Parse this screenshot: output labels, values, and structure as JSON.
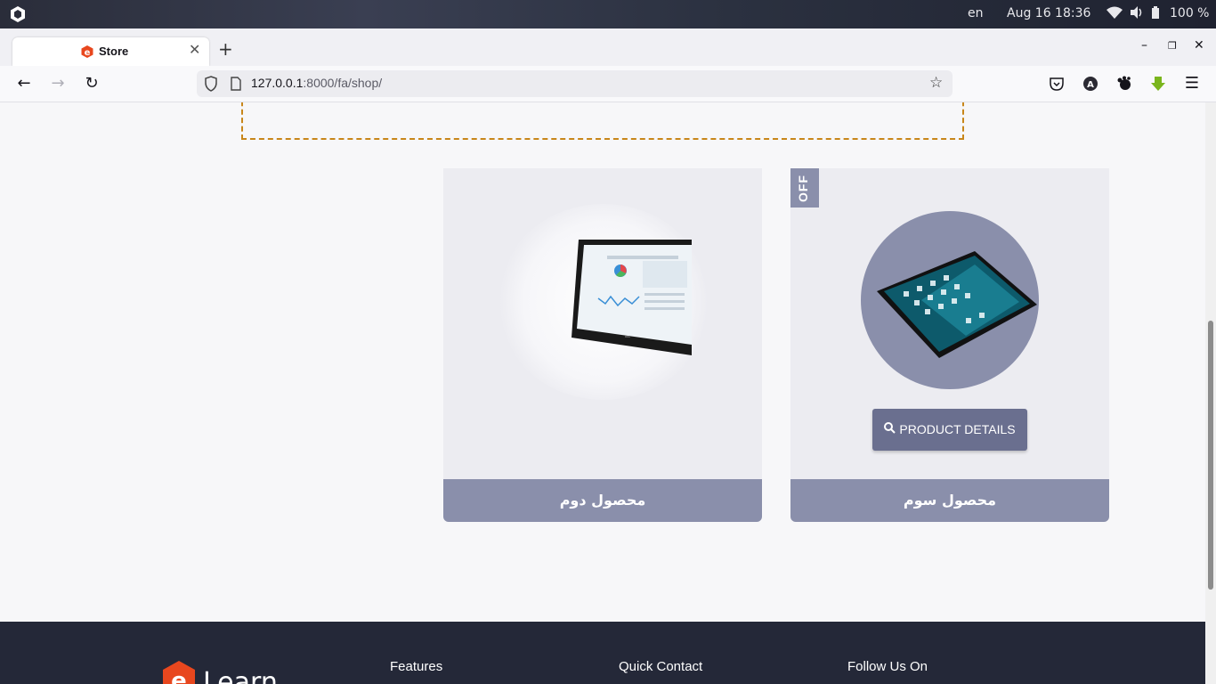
{
  "os": {
    "lang": "en",
    "datetime": "Aug 16  18:36",
    "battery": "100 %",
    "icons": [
      "distro-logo-icon",
      "wifi-icon",
      "volume-icon",
      "battery-icon"
    ]
  },
  "browser": {
    "tab_title": "Store",
    "url_host": "127.0.0.1",
    "url_path": ":8000/fa/shop/",
    "toolbar_icons": [
      "pocket-icon",
      "account-icon",
      "gnome-extension-icon",
      "download-icon",
      "menu-icon"
    ]
  },
  "products": [
    {
      "name": "محصول دوم",
      "has_off_badge": false
    },
    {
      "name": "محصول سوم",
      "badge": "OFF",
      "button_label": "PRODUCT DETAILS"
    }
  ],
  "footer": {
    "logo_text": "Learn",
    "cols": [
      "Features",
      "Quick Contact",
      "Follow Us On"
    ]
  },
  "colors": {
    "accent": "#8a8fab",
    "button": "#6a6f8f",
    "footer_bg": "#242838",
    "dashed_border": "#c8861a"
  }
}
